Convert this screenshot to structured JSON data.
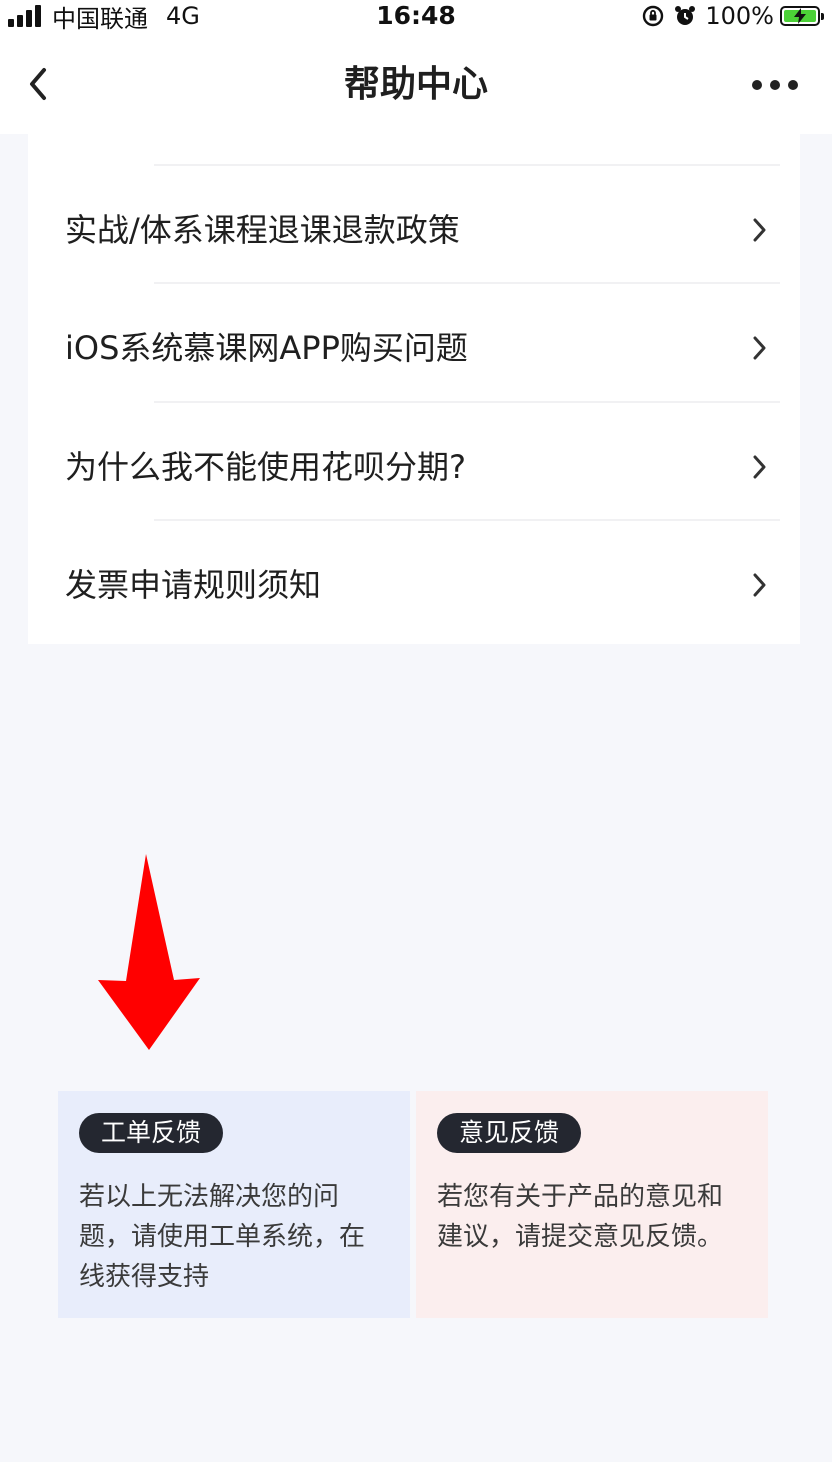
{
  "status_bar": {
    "carrier": "中国联通",
    "network": "4G",
    "time": "16:48",
    "battery": "100%",
    "battery_color": "#4cd137"
  },
  "nav": {
    "title": "帮助中心",
    "back_icon": "chevron-left-icon",
    "more_icon": "more-dots-icon"
  },
  "faq": {
    "items": [
      {
        "label": "实战/体系课程退课退款政策"
      },
      {
        "label": "iOS系统慕课网APP购买问题"
      },
      {
        "label": "为什么我不能使用花呗分期?"
      },
      {
        "label": "发票申请规则须知"
      }
    ]
  },
  "annotation": {
    "arrow_color": "#ff0000"
  },
  "feedback": {
    "ticket": {
      "badge": "工单反馈",
      "description": "若以上无法解决您的问题，请使用工单系统，在线获得支持",
      "color": "#e8edfb"
    },
    "opinion": {
      "badge": "意见反馈",
      "description": "若您有关于产品的意见和建议，请提交意见反馈。",
      "color": "#fbeeee"
    }
  }
}
